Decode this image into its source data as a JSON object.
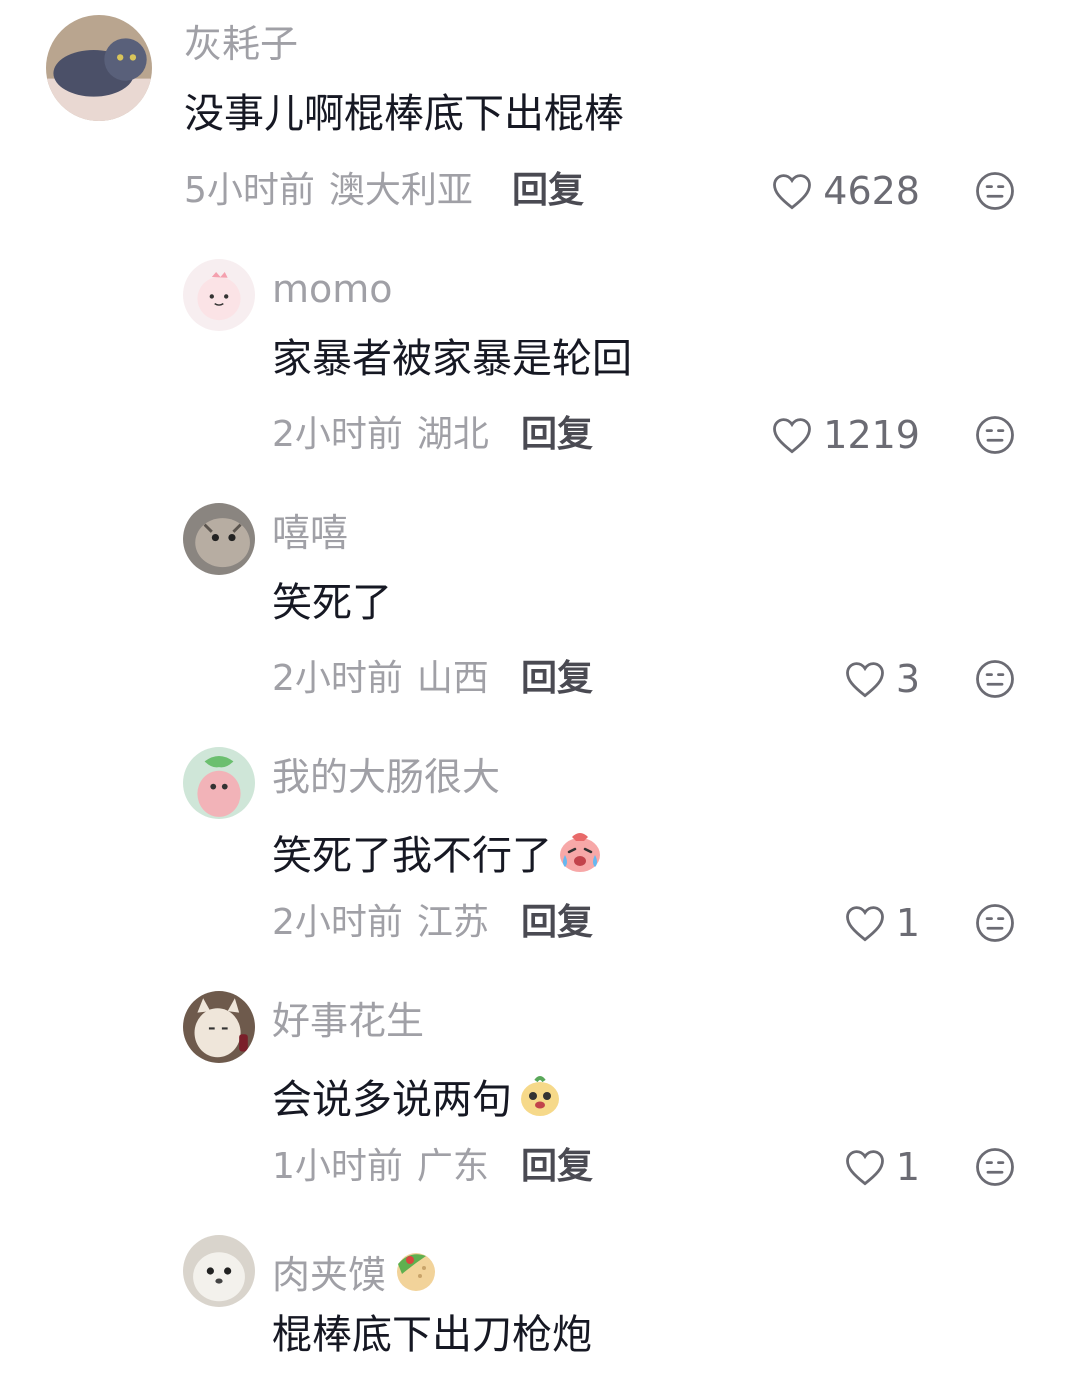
{
  "comments": [
    {
      "username": "灰耗子",
      "text": "没事儿啊棍棒底下出棍棒",
      "time": "5小时前",
      "location": "澳大利亚",
      "reply_label": "回复",
      "likes": "4628"
    },
    {
      "username": "momo",
      "text": "家暴者被家暴是轮回",
      "time": "2小时前",
      "location": "湖北",
      "reply_label": "回复",
      "likes": "1219"
    },
    {
      "username": "嘻嘻",
      "text": "笑死了",
      "time": "2小时前",
      "location": "山西",
      "reply_label": "回复",
      "likes": "3"
    },
    {
      "username": "我的大肠很大",
      "text": "笑死了我不行了",
      "time": "2小时前",
      "location": "江苏",
      "reply_label": "回复",
      "likes": "1"
    },
    {
      "username": "好事花生",
      "text": "会说多说两句",
      "time": "1小时前",
      "location": "广东",
      "reply_label": "回复",
      "likes": "1"
    },
    {
      "username": "肉夹馍",
      "text": "棍棒底下出刀枪炮"
    }
  ],
  "icons": {
    "like": "heart-outline-icon",
    "dislike": "neutral-face-icon"
  },
  "colors": {
    "username": "#a0a0a6",
    "text": "#161823",
    "reply": "#4a4a52"
  }
}
